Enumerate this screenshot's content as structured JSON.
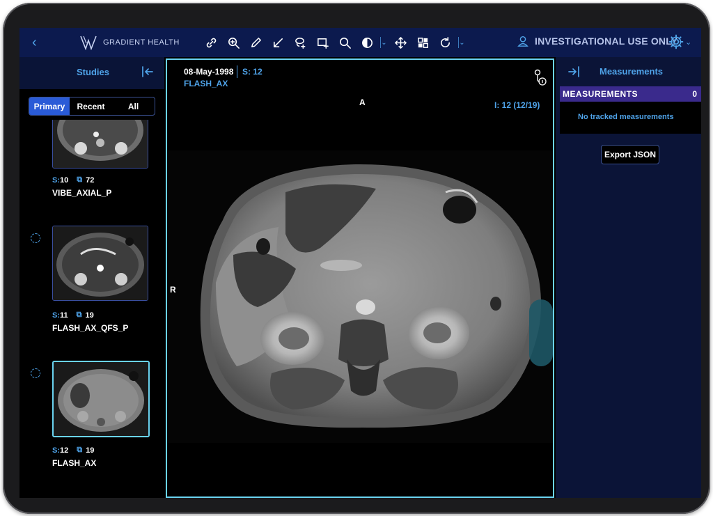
{
  "app": {
    "logo_text": "GRADIENT HEALTH",
    "status": "INVESTIGATIONAL USE ONLY"
  },
  "toolbar": {
    "tools": [
      "link-icon",
      "zoom-in-icon",
      "pencil-icon",
      "arrow-annotate-icon",
      "lasso-icon",
      "roi-add-icon",
      "magnifier-icon",
      "contrast-icon",
      "move-icon",
      "layout-icon",
      "rotate-icon"
    ]
  },
  "studies": {
    "title": "Studies",
    "tabs": [
      {
        "label": "Primary",
        "active": true
      },
      {
        "label": "Recent",
        "active": false
      },
      {
        "label": "All",
        "active": false
      }
    ],
    "series": [
      {
        "s_label": "S:",
        "s_num": "10",
        "count": "72",
        "name": "VIBE_AXIAL_P",
        "selected": false
      },
      {
        "s_label": "S:",
        "s_num": "11",
        "count": "19",
        "name": "FLASH_AX_QFS_P",
        "selected": false
      },
      {
        "s_label": "S:",
        "s_num": "12",
        "count": "19",
        "name": "FLASH_AX",
        "selected": true
      }
    ]
  },
  "viewer": {
    "date": "08-May-1998",
    "series": "S: 12",
    "description": "FLASH_AX",
    "orientation_top": "A",
    "orientation_left": "R",
    "image_index": "I: 12 (12/19)"
  },
  "measurements": {
    "title": "Measurements",
    "header_label": "MEASUREMENTS",
    "count": "0",
    "empty_text": "No tracked measurements",
    "export_label": "Export JSON"
  },
  "colors": {
    "accent": "#4fa3e9",
    "topbar": "#0c1a4e",
    "active_tab": "#2a5bd7",
    "viewport_border": "#6ad3f0",
    "measure_bar": "#3a2a8c"
  }
}
